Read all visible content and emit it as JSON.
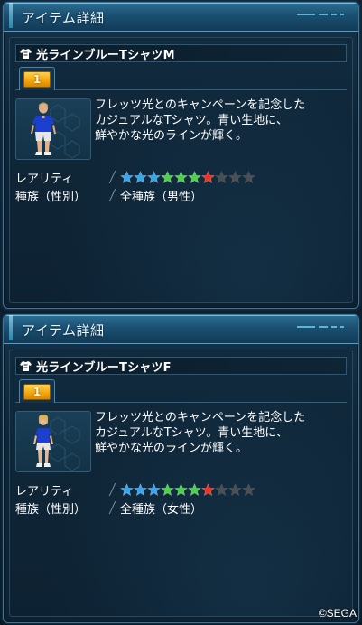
{
  "panels": [
    {
      "header_title": "アイテム詳細",
      "item_name": "光ラインブルーTシャツM",
      "tab_number": "1",
      "description_lines": [
        "フレッツ光とのキャンペーンを記念した",
        "カジュアルなTシャツ。青い生地に、",
        "鮮やかな光のラインが輝く。"
      ],
      "rarity_label": "レアリティ",
      "rarity": 7,
      "rarity_max": 10,
      "race_label": "種族（性別）",
      "race_value": "全種族（男性）",
      "portrait": "male-character"
    },
    {
      "header_title": "アイテム詳細",
      "item_name": "光ラインブルーTシャツF",
      "tab_number": "1",
      "description_lines": [
        "フレッツ光とのキャンペーンを記念した",
        "カジュアルなTシャツ。青い生地に、",
        "鮮やかな光のラインが輝く。"
      ],
      "rarity_label": "レアリティ",
      "rarity": 7,
      "rarity_max": 10,
      "race_label": "種族（性別）",
      "race_value": "全種族（女性）",
      "portrait": "female-character"
    }
  ],
  "star_colors": [
    "#3aa6ea",
    "#3aa6ea",
    "#3aa6ea",
    "#4cd14c",
    "#4cd14c",
    "#4cd14c",
    "#f0321e",
    "#4a4f55",
    "#4a4f55",
    "#4a4f55"
  ],
  "icons": {
    "item_type": "shirt-icon",
    "star": "star-icon"
  },
  "copyright": "©SEGA"
}
